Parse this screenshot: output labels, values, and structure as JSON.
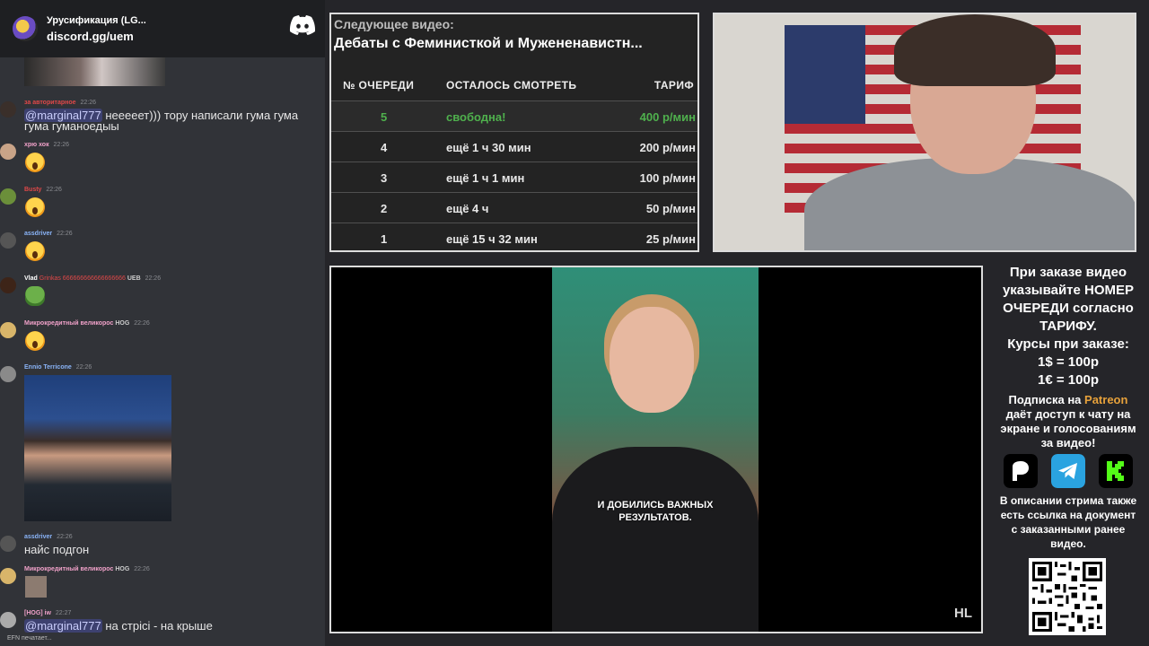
{
  "chat": {
    "server_name": "Урусификация (LG...",
    "invite": "discord.gg/uem",
    "typing": "EFN печатает...",
    "messages": [
      {
        "nick": "за авторитарное",
        "time": "22:26",
        "text_mention": "@marginal777",
        "text": " нееееет))) тору написали гума гума",
        "text2": "гума гуманоедыы"
      },
      {
        "nick": "хрю хок",
        "time": "22:26"
      },
      {
        "nick": "Busty",
        "time": "22:26"
      },
      {
        "nick": "assdriver",
        "time": "22:26"
      },
      {
        "nick": "Vlad",
        "nick_rest": "Grinkas 666666666666666666",
        "badge": "UEB",
        "time": "22:26"
      },
      {
        "nick": "Микрокредитный великорос",
        "badge": "HOG",
        "time": "22:26"
      },
      {
        "nick": "Ennio Terricone",
        "time": "22:26"
      },
      {
        "nick": "assdriver",
        "time": "22:26",
        "text": "найс подгон"
      },
      {
        "nick": "Микрокредитный великорос",
        "badge": "HOG",
        "time": "22:26"
      },
      {
        "nick": "[HOG] iw",
        "time": "22:27",
        "text_mention": "@marginal777",
        "text": " на стрісі - на крыше"
      }
    ]
  },
  "queue": {
    "next_label": "Следующее видео:",
    "next_title": "Дебаты с Феминисткой и Мужененавистн...",
    "headers": {
      "num": "№ ОЧЕРЕДИ",
      "left": "ОСТАЛОСЬ СМОТРЕТЬ",
      "tariff": "ТАРИФ"
    },
    "rows": [
      {
        "num": "5",
        "left": "свободна!",
        "tariff": "400 р/мин"
      },
      {
        "num": "4",
        "left": "ещё 1 ч 30 мин",
        "tariff": "200 р/мин"
      },
      {
        "num": "3",
        "left": "ещё 1 ч 1 мин",
        "tariff": "100 р/мин"
      },
      {
        "num": "2",
        "left": "ещё 4 ч",
        "tariff": "50 р/мин"
      },
      {
        "num": "1",
        "left": "ещё 15 ч 32 мин",
        "tariff": "25 р/мин"
      }
    ]
  },
  "video": {
    "subtitle_line1": "И ДОБИЛИСЬ ВАЖНЫХ",
    "subtitle_line2": "РЕЗУЛЬТАТОВ.",
    "logo": "HL"
  },
  "info": {
    "order_line1": "При заказе видео",
    "order_line2": "указывайте НОМЕР",
    "order_line3": "ОЧЕРЕДИ согласно",
    "order_line4": "ТАРИФУ.",
    "rates_title": "Курсы при заказе:",
    "rate_usd": "1$ = 100р",
    "rate_eur": "1€ = 100р",
    "sub_pre": "Подписка на ",
    "sub_patreon": "Patreon",
    "sub_line2": "даёт доступ к чату на",
    "sub_line3": "экране и голосованиям",
    "sub_line4": "за видео!",
    "desc_line1": "В описании стрима также",
    "desc_line2": "есть ссылка на документ",
    "desc_line3": "с заказанными ранее",
    "desc_line4": "видео."
  },
  "colors": {
    "free_slot": "#4fb14d",
    "patreon": "#e6a13b",
    "telegram": "#2aa3e0",
    "kick": "#53fc18"
  },
  "icons": [
    "discord-icon",
    "patreon-icon",
    "telegram-icon",
    "kick-icon",
    "qr-code"
  ]
}
